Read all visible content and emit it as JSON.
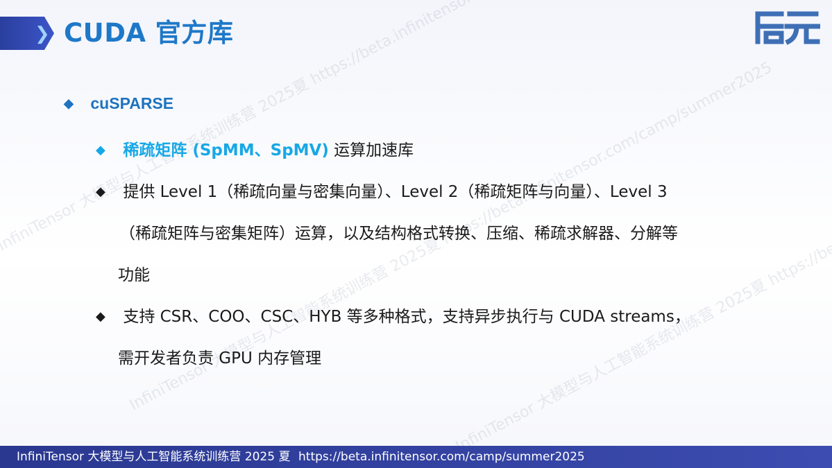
{
  "header": {
    "title": "CUDA 官方库",
    "logo_text": "启元"
  },
  "content": {
    "level1": {
      "label": "cuSPARSE"
    },
    "bullets": [
      {
        "highlight": "稀疏矩阵 (SpMM、SpMV)",
        "rest": " 运算加速库"
      },
      {
        "lines": [
          "提供 Level 1（稀疏向量与密集向量）、Level 2（稀疏矩阵与向量）、Level 3",
          "（稀疏矩阵与密集矩阵）运算，以及结构格式转换、压缩、稀疏求解器、分解等",
          "功能"
        ]
      },
      {
        "lines": [
          "支持 CSR、COO、CSC、HYB 等多种格式，支持异步执行与 CUDA streams，",
          "需开发者负责 GPU 内存管理"
        ]
      }
    ]
  },
  "watermark": {
    "text": "InfiniTensor 大模型与人工智能系统训练营 2025夏 https://beta.infinitensor.com/camp/summer2025"
  },
  "footer": {
    "left": "InfiniTensor 大模型与人工智能系统训练营 2025 夏",
    "right": "https://beta.infinitensor.com/camp/summer2025"
  },
  "colors": {
    "title": "#1e78c8",
    "accent": "#18a8e6",
    "footer_bg": "#2a3890"
  }
}
